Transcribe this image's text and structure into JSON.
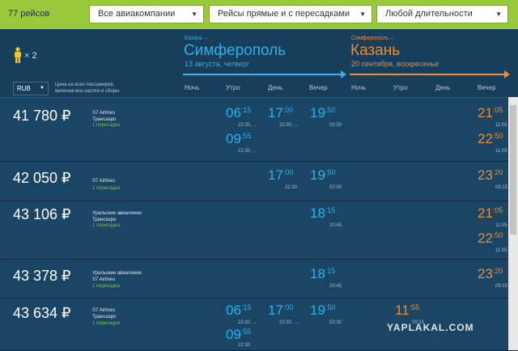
{
  "filters": {
    "count": "77 рейсов",
    "airlines": "Все авиакомпании",
    "connections": "Рейсы прямые и с пересадками",
    "duration": "Любой длительности"
  },
  "passengers": {
    "count": "× 2",
    "icon": "person-icon"
  },
  "currency": {
    "selected": "RUB",
    "note_line1": "Цена на всех пассажиров,",
    "note_line2": "включая все налоги и сборы"
  },
  "outbound": {
    "small": "Казань –",
    "city": "Симферополь",
    "date": "13 августа, четверг",
    "color": "#2fb0e8",
    "times_of_day": [
      "Ночь",
      "Утро",
      "День",
      "Вечер"
    ]
  },
  "inbound": {
    "small": "Симферополь –",
    "city": "Казань",
    "date": "20 сентября, воскресенье",
    "color": "#f08c30",
    "times_of_day": [
      "Ночь",
      "Утро",
      "День",
      "Вечер"
    ]
  },
  "results": [
    {
      "price": "41 780 ₽",
      "airline1": "S7 Airlines",
      "airline2": "Трансаэро",
      "stops": "1 пересадка",
      "out": [
        {
          "h": "06",
          "m": ":15",
          "arr": "22:30, ..."
        },
        {
          "h": "17",
          "m": ":00",
          "arr": "22:30, ..."
        },
        {
          "h": "19",
          "m": ":50",
          "arr": "02:30"
        },
        {
          "h": "09",
          "m": ":55",
          "arr": "22:30, ..."
        }
      ],
      "ret": [
        {
          "h": "21",
          "m": ":05",
          "arr": "11:05"
        },
        {
          "h": "22",
          "m": ":50",
          "arr": "11:05"
        }
      ]
    },
    {
      "price": "42 050 ₽",
      "airline1": "S7 Airlines",
      "airline2": "",
      "stops": "1 пересадка",
      "out": [
        {
          "h": "17",
          "m": ":00",
          "arr": "22:30"
        },
        {
          "h": "19",
          "m": ":50",
          "arr": "02:30"
        }
      ],
      "ret": [
        {
          "h": "23",
          "m": ":20",
          "arr": "09:15"
        }
      ]
    },
    {
      "price": "43 106 ₽",
      "airline1": "Уральские авиалинии",
      "airline2": "Трансаэро",
      "stops": "1 пересадка",
      "out": [
        {
          "h": "18",
          "m": ":15",
          "arr": "20:45"
        }
      ],
      "ret": [
        {
          "h": "21",
          "m": ":05",
          "arr": "11:05"
        },
        {
          "h": "22",
          "m": ":50",
          "arr": "11:05"
        }
      ]
    },
    {
      "price": "43 378 ₽",
      "airline1": "Уральские авиалинии",
      "airline2": "S7 Airlines",
      "stops": "1 пересадка",
      "out": [
        {
          "h": "18",
          "m": ":15",
          "arr": "20:45"
        }
      ],
      "ret": [
        {
          "h": "23",
          "m": ":20",
          "arr": "09:15"
        }
      ]
    },
    {
      "price": "43 634 ₽",
      "airline1": "S7 Airlines",
      "airline2": "Трансаэро",
      "stops": "1 пересадка",
      "out": [
        {
          "h": "06",
          "m": ":15",
          "arr": "22:30, ..."
        },
        {
          "h": "17",
          "m": ":00",
          "arr": "22:30, ..."
        },
        {
          "h": "19",
          "m": ":50",
          "arr": "02:30"
        },
        {
          "h": "09",
          "m": ":55",
          "arr": "22:30"
        }
      ],
      "ret": [
        {
          "h": "11",
          "m": ":55",
          "arr": "09:15"
        }
      ]
    }
  ],
  "watermark": "YAPLAKAL.COM"
}
